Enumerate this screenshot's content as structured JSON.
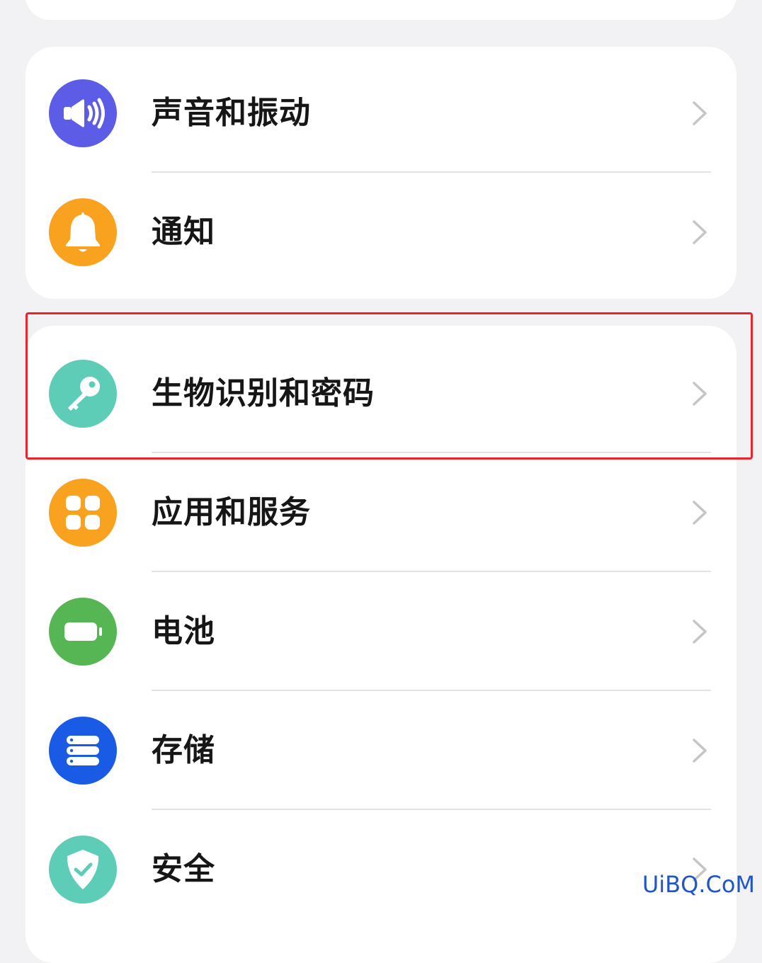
{
  "settings": {
    "items": [
      {
        "label": "声音和振动",
        "icon": "speaker-icon",
        "color": "#5c5ce6"
      },
      {
        "label": "通知",
        "icon": "bell-icon",
        "color": "#f8a21f"
      },
      {
        "label": "生物识别和密码",
        "icon": "key-icon",
        "color": "#5ecdb8"
      },
      {
        "label": "应用和服务",
        "icon": "apps-grid-icon",
        "color": "#f8a21f"
      },
      {
        "label": "电池",
        "icon": "battery-icon",
        "color": "#57b654"
      },
      {
        "label": "存储",
        "icon": "storage-icon",
        "color": "#1a5be6"
      },
      {
        "label": "安全",
        "icon": "shield-icon",
        "color": "#5ecdb8"
      }
    ]
  },
  "watermark": "UiBQ.CoM",
  "highlight_color": "#e8252b"
}
